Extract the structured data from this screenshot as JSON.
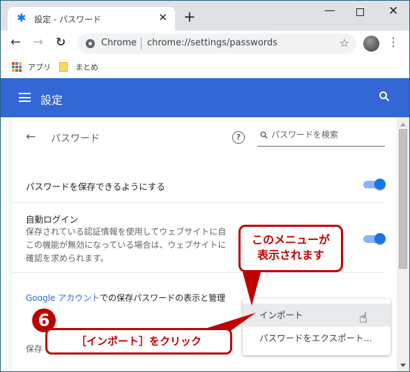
{
  "browser": {
    "tab": {
      "icon": "gear-icon",
      "title": "設定 - パスワード",
      "close": "✕"
    },
    "new_tab": "+",
    "window_controls": {
      "minimize": "—",
      "maximize": "",
      "close": "✕"
    },
    "nav": {
      "back": "←",
      "forward": "→",
      "reload": "C"
    },
    "omnibox": {
      "site_label": "Chrome",
      "url": "chrome://settings/passwords",
      "star": "☆"
    },
    "menu": "⋮",
    "bookmarks": [
      {
        "icon": "apps-grid-icon",
        "label": "アプリ"
      },
      {
        "icon": "folder-icon",
        "label": "まとめ"
      }
    ],
    "apps_colors": [
      "#ea4335",
      "#4285f4",
      "#fbbc04",
      "#34a853",
      "#ea4335",
      "#4285f4",
      "#fbbc04",
      "#34a853",
      "#ea4335"
    ]
  },
  "settings": {
    "header": {
      "title": "設定",
      "search_icon": "⚲"
    },
    "subpage": {
      "back": "←",
      "title": "パスワード",
      "help": "?",
      "search_placeholder": "パスワードを検索"
    },
    "offer_save": {
      "label": "パスワードを保存できるようにする",
      "enabled": true
    },
    "auto_signin": {
      "label": "自動ログイン",
      "description_lines": [
        "保存されている認証情報を使用してウェブサイトに自",
        "この機能が無効になっている場合は、ウェブサイトに",
        "確認を求められます。"
      ],
      "enabled": true
    },
    "google_account": {
      "link": "Google アカウント",
      "rest": "での保存パスワードの表示と管理"
    },
    "saved_label": "保存",
    "menu": {
      "items": [
        {
          "label": "インポート",
          "hovered": true
        },
        {
          "label": "パスワードをエクスポート..."
        }
      ]
    }
  },
  "annotations": {
    "callout_menu": [
      "このメニューが",
      "表示されます"
    ],
    "step_number": "6",
    "callout_click": "［インポート］をクリック"
  },
  "colors": {
    "header_blue": "#3367d6",
    "toggle_on": "#1a73e8",
    "annotation_red": "#c00000"
  }
}
